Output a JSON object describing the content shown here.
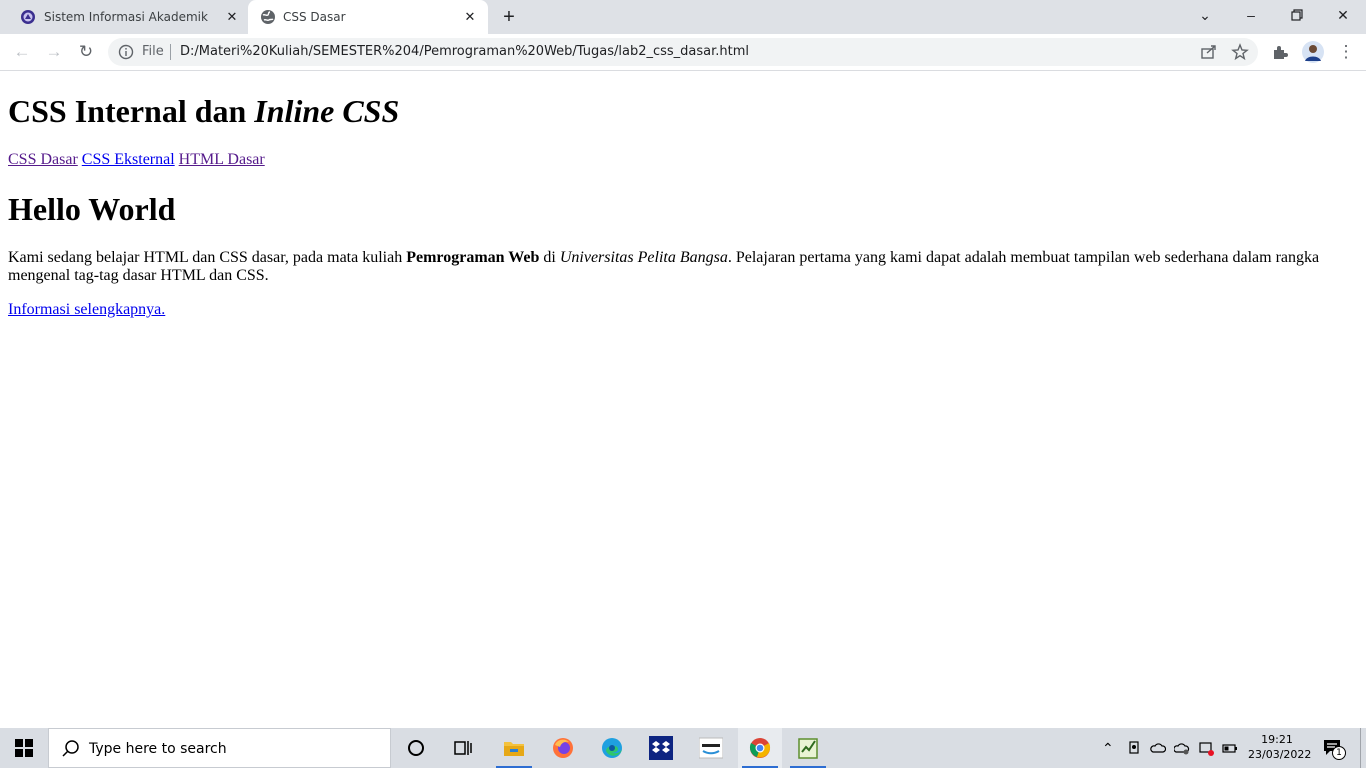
{
  "browser": {
    "tabs": [
      {
        "title": "Sistem Informasi Akademik",
        "icon": "university-logo-icon",
        "active": false
      },
      {
        "title": "CSS Dasar",
        "icon": "globe-icon",
        "active": true
      }
    ],
    "address": {
      "scheme_label": "File",
      "url": "D:/Materi%20Kuliah/SEMESTER%204/Pemrograman%20Web/Tugas/lab2_css_dasar.html"
    }
  },
  "page": {
    "heading": {
      "plain": "CSS Internal dan ",
      "italic": "Inline CSS"
    },
    "nav_links": [
      {
        "label": "CSS Dasar",
        "visited": true
      },
      {
        "label": "CSS Eksternal",
        "visited": false
      },
      {
        "label": "HTML Dasar",
        "visited": true
      }
    ],
    "subheading": "Hello World",
    "paragraph": {
      "part1": "Kami sedang belajar HTML dan CSS dasar, pada mata kuliah ",
      "bold": "Pemrograman Web",
      "part2": " di ",
      "italic": "Universitas Pelita Bangsa",
      "part3": ". Pelajaran pertama yang kami dapat adalah membuat tampilan web sederhana dalam rangka mengenal tag-tag dasar HTML dan CSS."
    },
    "more_link": "Informasi selengkapnya."
  },
  "taskbar": {
    "search_placeholder": "Type here to search",
    "time": "19:21",
    "date": "23/03/2022",
    "notification_count": "1",
    "pinned_apps": [
      "cortana-icon",
      "task-view-icon",
      "file-explorer-icon",
      "firefox-icon",
      "edge-icon",
      "dropbox-icon",
      "amazon-icon",
      "chrome-icon",
      "sublime-notepad-icon"
    ]
  },
  "colors": {
    "visited_link": "#551a8b",
    "unvisited_link": "#0000ee",
    "tabstrip_bg": "#dee1e6",
    "taskbar_bg": "#d9dde3"
  }
}
